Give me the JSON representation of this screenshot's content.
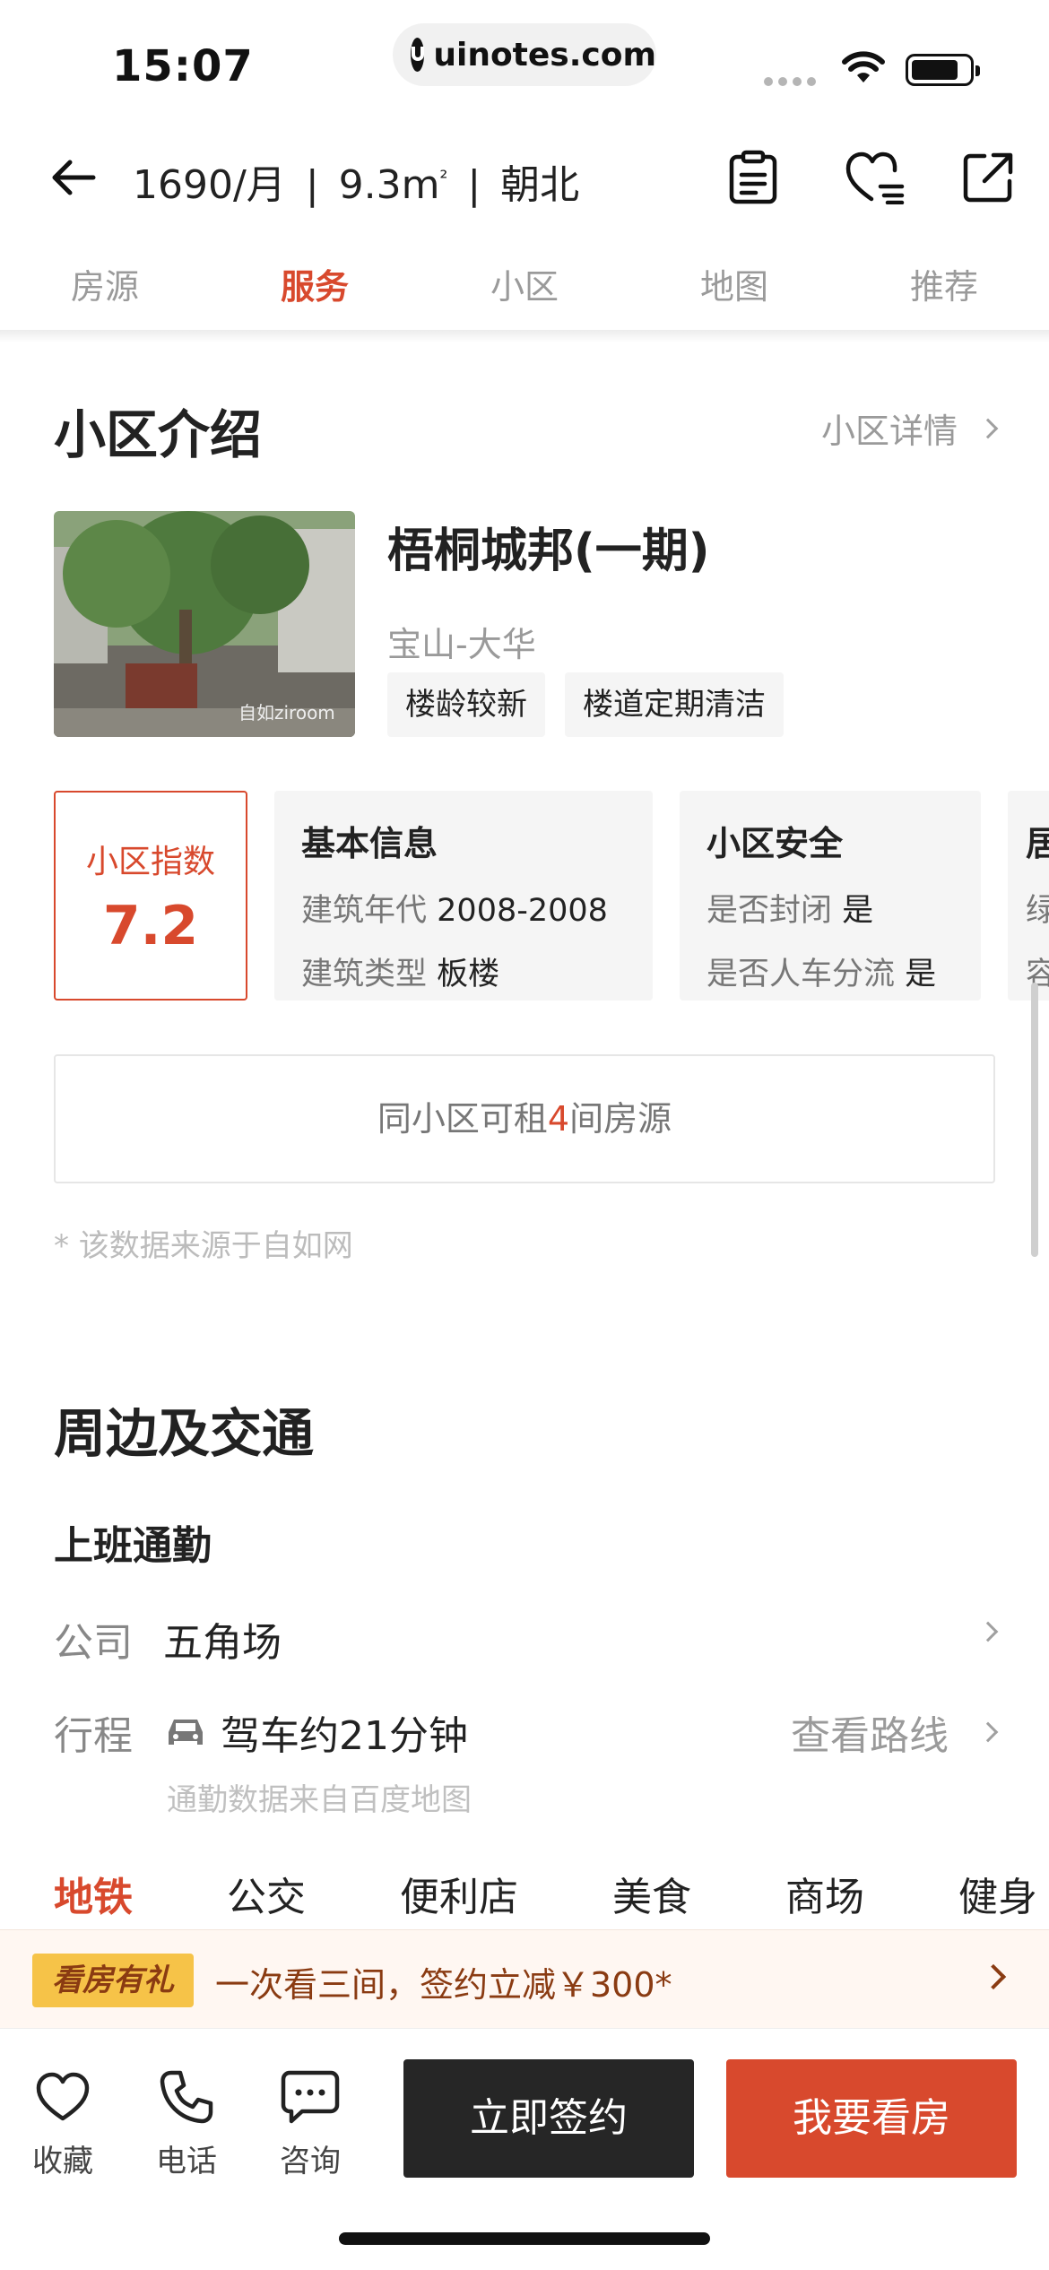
{
  "status_bar": {
    "time": "15:07",
    "url": "uinotes.com"
  },
  "header": {
    "price": "1690/月",
    "area": "9.3m",
    "area_sup": "²",
    "facing": "朝北",
    "sep": "|"
  },
  "tabs": [
    {
      "label": "房源",
      "active": false
    },
    {
      "label": "服务",
      "active": true
    },
    {
      "label": "小区",
      "active": false
    },
    {
      "label": "地图",
      "active": false
    },
    {
      "label": "推荐",
      "active": false
    }
  ],
  "community": {
    "section_title": "小区介绍",
    "detail_link": "小区详情",
    "name": "梧桐城邦(一期)",
    "location": "宝山-大华",
    "photo_watermark": "自如ziroom",
    "tags": [
      "楼龄较新",
      "楼道定期清洁"
    ],
    "score": {
      "label": "小区指数",
      "value": "7.2"
    },
    "cards": [
      {
        "title": "基本信息",
        "rows": [
          {
            "k": "建筑年代",
            "v": "2008-2008"
          },
          {
            "k": "建筑类型",
            "v": "板楼"
          }
        ]
      },
      {
        "title": "小区安全",
        "rows": [
          {
            "k": "是否封闭",
            "v": "是"
          },
          {
            "k": "是否人车分流",
            "v": "是"
          }
        ]
      },
      {
        "title": "居",
        "rows": [
          {
            "k": "绿",
            "v": ""
          },
          {
            "k": "容",
            "v": ""
          }
        ]
      }
    ],
    "same_community": {
      "prefix": "同小区可租",
      "count": "4",
      "suffix": "间房源"
    },
    "source_note": "* 该数据来源于自如网"
  },
  "traffic": {
    "section_title": "周边及交通",
    "commute_title": "上班通勤",
    "company_label": "公司",
    "company_value": "五角场",
    "trip_label": "行程",
    "trip_value": "驾车约21分钟",
    "route_link": "查看路线",
    "commute_note": "通勤数据来自百度地图",
    "categories": [
      {
        "label": "地铁",
        "active": true
      },
      {
        "label": "公交",
        "active": false
      },
      {
        "label": "便利店",
        "active": false
      },
      {
        "label": "美食",
        "active": false
      },
      {
        "label": "商场",
        "active": false
      },
      {
        "label": "健身",
        "active": false
      }
    ]
  },
  "promo": {
    "badge": "看房有礼",
    "text": "一次看三间，签约立减￥300*"
  },
  "bottom_bar": {
    "favorite": "收藏",
    "phone": "电话",
    "consult": "咨询",
    "sign": "立即签约",
    "view": "我要看房"
  },
  "colors": {
    "accent": "#d8492d",
    "dark_button": "#262626",
    "promo_badge": "#f6c348",
    "promo_text": "#8a3b12"
  },
  "icons": [
    "back-arrow-icon",
    "clipboard-icon",
    "heart-list-icon",
    "share-icon",
    "car-icon",
    "chevron-right-icon",
    "heart-icon",
    "phone-icon",
    "chat-icon"
  ]
}
